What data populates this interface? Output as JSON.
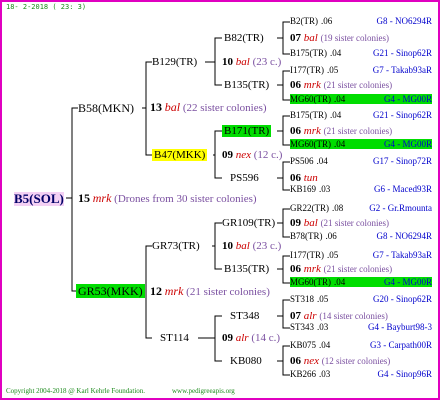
{
  "header": {
    "date": "18-  2-2018 ( 23:  3)"
  },
  "watermark": "",
  "root": {
    "id": "B5(SOL)",
    "num": "15",
    "race": "mrk",
    "note": "(Drones from 30 sister colonies)"
  },
  "gen1": [
    {
      "id": "B58(MKN)",
      "num": "13",
      "race": "bal",
      "note": "(22 sister colonies)"
    },
    {
      "id": "GR53(MKK)",
      "num": "12",
      "race": "mrk",
      "note": "(21 sister colonies)"
    }
  ],
  "gen2": [
    {
      "id": "B129(TR)",
      "num": "10",
      "race": "bal",
      "note": "(23 c.)"
    },
    {
      "id": "B47(MKK)",
      "num": "09",
      "race": "nex",
      "note": "(12 c.)"
    },
    {
      "id": "GR73(TR)",
      "num": "10",
      "race": "bal",
      "note": "(23 c.)"
    },
    {
      "id": "ST114",
      "num": "09",
      "race": "alr",
      "note": "(14 c.)"
    }
  ],
  "gen3": [
    {
      "id": "B82(TR)",
      "num": "07",
      "race": "bal",
      "note": "(19 sister colonies)"
    },
    {
      "id": "B135(TR)",
      "num": "06",
      "race": "mrk",
      "note": "(21 sister colonies)"
    },
    {
      "id": "B171(TR)",
      "num": "06",
      "race": "mrk",
      "note": "(21 sister colonies)"
    },
    {
      "id": "PS596",
      "num": "06",
      "race": "tun",
      "note": ""
    },
    {
      "id": "GR109(TR)",
      "num": "09",
      "race": "bal",
      "note": "(21 sister colonies)"
    },
    {
      "id": "B135(TR)",
      "num": "06",
      "race": "mrk",
      "note": "(21 sister colonies)"
    },
    {
      "id": "ST348",
      "num": "07",
      "race": "alr",
      "note": "(14 sister colonies)"
    },
    {
      "id": "KB080",
      "num": "06",
      "race": "nex",
      "note": "(12 sister colonies)"
    }
  ],
  "gen4": [
    {
      "id": "B2(TR)",
      "yr": ".06",
      "code": "G8 - NO6294R"
    },
    {
      "id": "B175(TR)",
      "yr": ".04",
      "code": "G21 - Sinop62R"
    },
    {
      "id": "I177(TR)",
      "yr": ".05",
      "code": "G7 - Takab93aR"
    },
    {
      "id": "MG60(TR)",
      "yr": ".04",
      "code": "G4 - MG00R"
    },
    {
      "id": "B175(TR)",
      "yr": ".04",
      "code": "G21 - Sinop62R"
    },
    {
      "id": "MG60(TR)",
      "yr": ".04",
      "code": "G4 - MG00R"
    },
    {
      "id": "PS506",
      "yr": ".04",
      "code": "G17 - Sinop72R"
    },
    {
      "id": "KB169",
      "yr": ".03",
      "code": "G6 - Maced93R"
    },
    {
      "id": "GR22(TR)",
      "yr": ".08",
      "code": "G2 - Gr.Rmounta"
    },
    {
      "id": "B78(TR)",
      "yr": ".06",
      "code": "G8 - NO6294R"
    },
    {
      "id": "I177(TR)",
      "yr": ".05",
      "code": "G7 - Takab93aR"
    },
    {
      "id": "MG60(TR)",
      "yr": ".04",
      "code": "G4 - MG00R"
    },
    {
      "id": "ST318",
      "yr": ".05",
      "code": "G20 - Sinop62R"
    },
    {
      "id": "ST343",
      "yr": ".03",
      "code": "G4 - Bayburt98-3"
    },
    {
      "id": "KB075",
      "yr": ".04",
      "code": "G3 - Carpath00R"
    },
    {
      "id": "KB266",
      "yr": ".03",
      "code": "G4 - Sinop96R"
    }
  ],
  "footer": {
    "copyright": "Copyright 2004-2018 @ Karl Kehrle Foundation.",
    "url": "www.pedigreeapis.org"
  },
  "colors": {
    "border": "#e000c0",
    "green": "#00dd00",
    "yellow": "#ffff00",
    "root_bg": "#f4d0f4",
    "red_text": "#cc0000",
    "code_text": "#0000cc"
  }
}
